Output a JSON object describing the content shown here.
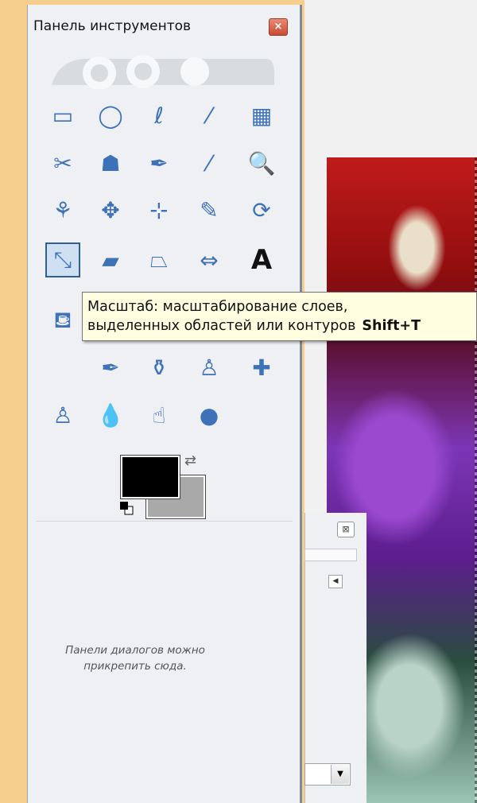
{
  "toolbox": {
    "title": "Панель инструментов",
    "close_label": "×"
  },
  "tools": [
    {
      "name": "rect-select-tool",
      "icon": "rectangle-select-icon",
      "glyph": "▭"
    },
    {
      "name": "ellipse-select-tool",
      "icon": "ellipse-select-icon",
      "glyph": "◯"
    },
    {
      "name": "free-select-tool",
      "icon": "lasso-icon",
      "glyph": "ℓ"
    },
    {
      "name": "fuzzy-select-tool",
      "icon": "magic-wand-icon",
      "glyph": "⁄"
    },
    {
      "name": "select-by-color-tool",
      "icon": "color-select-icon",
      "glyph": "▦"
    },
    {
      "name": "scissors-select-tool",
      "icon": "scissors-icon",
      "glyph": "✂"
    },
    {
      "name": "foreground-select-tool",
      "icon": "foreground-select-icon",
      "glyph": "☗"
    },
    {
      "name": "paths-tool",
      "icon": "paths-pen-icon",
      "glyph": "✒"
    },
    {
      "name": "color-picker-tool",
      "icon": "eyedropper-icon",
      "glyph": "⁄"
    },
    {
      "name": "zoom-tool",
      "icon": "magnifier-icon",
      "glyph": "🔍"
    },
    {
      "name": "measure-tool",
      "icon": "compass-icon",
      "glyph": "⚘"
    },
    {
      "name": "move-tool",
      "icon": "move-arrows-icon",
      "glyph": "✥"
    },
    {
      "name": "align-tool",
      "icon": "align-icon",
      "glyph": "⊹"
    },
    {
      "name": "crop-tool",
      "icon": "crop-knife-icon",
      "glyph": "✎"
    },
    {
      "name": "rotate-tool",
      "icon": "rotate-icon",
      "glyph": "⟳"
    },
    {
      "name": "scale-tool",
      "icon": "scale-icon",
      "glyph": "⤡"
    },
    {
      "name": "shear-tool",
      "icon": "shear-icon",
      "glyph": "▰"
    },
    {
      "name": "perspective-tool",
      "icon": "perspective-icon",
      "glyph": "⏢"
    },
    {
      "name": "flip-tool",
      "icon": "flip-icon",
      "glyph": "⇔"
    },
    {
      "name": "text-tool",
      "icon": "text-A-icon",
      "glyph": "A"
    },
    {
      "name": "bucket-fill-tool",
      "icon": "bucket-icon",
      "glyph": "⛾"
    },
    {
      "name": "ink-tool",
      "icon": "ink-pen-icon",
      "glyph": "✒"
    },
    {
      "name": "mypaint-tool",
      "icon": "ink-bottle-icon",
      "glyph": "⚱"
    },
    {
      "name": "clone-tool",
      "icon": "clone-stamp-icon",
      "glyph": "♙"
    },
    {
      "name": "heal-tool",
      "icon": "bandage-icon",
      "glyph": "✚"
    },
    {
      "name": "perspective-clone-tool",
      "icon": "perspective-clone-icon",
      "glyph": "♙"
    },
    {
      "name": "blur-tool",
      "icon": "water-drop-icon",
      "glyph": "💧"
    },
    {
      "name": "smudge-tool",
      "icon": "smudge-finger-icon",
      "glyph": "☝"
    },
    {
      "name": "dodge-burn-tool",
      "icon": "dodge-burn-icon",
      "glyph": "●"
    }
  ],
  "tooltip": {
    "line1": "Масштаб: масштабирование слоев,",
    "line2": "выделенных областей или контуров",
    "shortcut": "Shift+T"
  },
  "colors": {
    "foreground": "#000000",
    "background": "#a9a9a9"
  },
  "dock": {
    "line1": "Панели диалогов можно",
    "line2": "прикрепить сюда."
  },
  "dialog_panel": {
    "close_label": "⊠",
    "arrow_label": "◀",
    "dropdown_arrow": "▼"
  }
}
